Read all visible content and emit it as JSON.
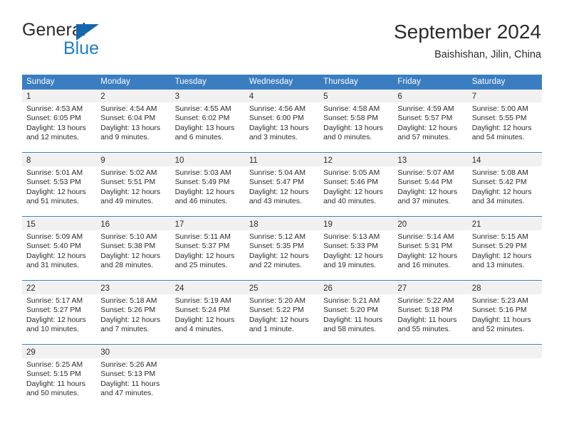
{
  "brand": {
    "name_part1": "General",
    "name_part2": "Blue",
    "triangle_color": "#1467ab",
    "blue_color": "#1f7ec4"
  },
  "header": {
    "title": "September 2024",
    "subtitle": "Baishishan, Jilin, China"
  },
  "theme": {
    "header_bg": "#3b7dc1",
    "header_text": "#ffffff",
    "daynum_band_bg": "#f1f1f1",
    "cell_bg": "#ffffff",
    "text": "#2b2b2b"
  },
  "weekdays": [
    "Sunday",
    "Monday",
    "Tuesday",
    "Wednesday",
    "Thursday",
    "Friday",
    "Saturday"
  ],
  "weeks": [
    [
      {
        "day": "1",
        "sunrise": "Sunrise: 4:53 AM",
        "sunset": "Sunset: 6:05 PM",
        "daylight1": "Daylight: 13 hours",
        "daylight2": "and 12 minutes."
      },
      {
        "day": "2",
        "sunrise": "Sunrise: 4:54 AM",
        "sunset": "Sunset: 6:04 PM",
        "daylight1": "Daylight: 13 hours",
        "daylight2": "and 9 minutes."
      },
      {
        "day": "3",
        "sunrise": "Sunrise: 4:55 AM",
        "sunset": "Sunset: 6:02 PM",
        "daylight1": "Daylight: 13 hours",
        "daylight2": "and 6 minutes."
      },
      {
        "day": "4",
        "sunrise": "Sunrise: 4:56 AM",
        "sunset": "Sunset: 6:00 PM",
        "daylight1": "Daylight: 13 hours",
        "daylight2": "and 3 minutes."
      },
      {
        "day": "5",
        "sunrise": "Sunrise: 4:58 AM",
        "sunset": "Sunset: 5:58 PM",
        "daylight1": "Daylight: 13 hours",
        "daylight2": "and 0 minutes."
      },
      {
        "day": "6",
        "sunrise": "Sunrise: 4:59 AM",
        "sunset": "Sunset: 5:57 PM",
        "daylight1": "Daylight: 12 hours",
        "daylight2": "and 57 minutes."
      },
      {
        "day": "7",
        "sunrise": "Sunrise: 5:00 AM",
        "sunset": "Sunset: 5:55 PM",
        "daylight1": "Daylight: 12 hours",
        "daylight2": "and 54 minutes."
      }
    ],
    [
      {
        "day": "8",
        "sunrise": "Sunrise: 5:01 AM",
        "sunset": "Sunset: 5:53 PM",
        "daylight1": "Daylight: 12 hours",
        "daylight2": "and 51 minutes."
      },
      {
        "day": "9",
        "sunrise": "Sunrise: 5:02 AM",
        "sunset": "Sunset: 5:51 PM",
        "daylight1": "Daylight: 12 hours",
        "daylight2": "and 49 minutes."
      },
      {
        "day": "10",
        "sunrise": "Sunrise: 5:03 AM",
        "sunset": "Sunset: 5:49 PM",
        "daylight1": "Daylight: 12 hours",
        "daylight2": "and 46 minutes."
      },
      {
        "day": "11",
        "sunrise": "Sunrise: 5:04 AM",
        "sunset": "Sunset: 5:47 PM",
        "daylight1": "Daylight: 12 hours",
        "daylight2": "and 43 minutes."
      },
      {
        "day": "12",
        "sunrise": "Sunrise: 5:05 AM",
        "sunset": "Sunset: 5:46 PM",
        "daylight1": "Daylight: 12 hours",
        "daylight2": "and 40 minutes."
      },
      {
        "day": "13",
        "sunrise": "Sunrise: 5:07 AM",
        "sunset": "Sunset: 5:44 PM",
        "daylight1": "Daylight: 12 hours",
        "daylight2": "and 37 minutes."
      },
      {
        "day": "14",
        "sunrise": "Sunrise: 5:08 AM",
        "sunset": "Sunset: 5:42 PM",
        "daylight1": "Daylight: 12 hours",
        "daylight2": "and 34 minutes."
      }
    ],
    [
      {
        "day": "15",
        "sunrise": "Sunrise: 5:09 AM",
        "sunset": "Sunset: 5:40 PM",
        "daylight1": "Daylight: 12 hours",
        "daylight2": "and 31 minutes."
      },
      {
        "day": "16",
        "sunrise": "Sunrise: 5:10 AM",
        "sunset": "Sunset: 5:38 PM",
        "daylight1": "Daylight: 12 hours",
        "daylight2": "and 28 minutes."
      },
      {
        "day": "17",
        "sunrise": "Sunrise: 5:11 AM",
        "sunset": "Sunset: 5:37 PM",
        "daylight1": "Daylight: 12 hours",
        "daylight2": "and 25 minutes."
      },
      {
        "day": "18",
        "sunrise": "Sunrise: 5:12 AM",
        "sunset": "Sunset: 5:35 PM",
        "daylight1": "Daylight: 12 hours",
        "daylight2": "and 22 minutes."
      },
      {
        "day": "19",
        "sunrise": "Sunrise: 5:13 AM",
        "sunset": "Sunset: 5:33 PM",
        "daylight1": "Daylight: 12 hours",
        "daylight2": "and 19 minutes."
      },
      {
        "day": "20",
        "sunrise": "Sunrise: 5:14 AM",
        "sunset": "Sunset: 5:31 PM",
        "daylight1": "Daylight: 12 hours",
        "daylight2": "and 16 minutes."
      },
      {
        "day": "21",
        "sunrise": "Sunrise: 5:15 AM",
        "sunset": "Sunset: 5:29 PM",
        "daylight1": "Daylight: 12 hours",
        "daylight2": "and 13 minutes."
      }
    ],
    [
      {
        "day": "22",
        "sunrise": "Sunrise: 5:17 AM",
        "sunset": "Sunset: 5:27 PM",
        "daylight1": "Daylight: 12 hours",
        "daylight2": "and 10 minutes."
      },
      {
        "day": "23",
        "sunrise": "Sunrise: 5:18 AM",
        "sunset": "Sunset: 5:26 PM",
        "daylight1": "Daylight: 12 hours",
        "daylight2": "and 7 minutes."
      },
      {
        "day": "24",
        "sunrise": "Sunrise: 5:19 AM",
        "sunset": "Sunset: 5:24 PM",
        "daylight1": "Daylight: 12 hours",
        "daylight2": "and 4 minutes."
      },
      {
        "day": "25",
        "sunrise": "Sunrise: 5:20 AM",
        "sunset": "Sunset: 5:22 PM",
        "daylight1": "Daylight: 12 hours",
        "daylight2": "and 1 minute."
      },
      {
        "day": "26",
        "sunrise": "Sunrise: 5:21 AM",
        "sunset": "Sunset: 5:20 PM",
        "daylight1": "Daylight: 11 hours",
        "daylight2": "and 58 minutes."
      },
      {
        "day": "27",
        "sunrise": "Sunrise: 5:22 AM",
        "sunset": "Sunset: 5:18 PM",
        "daylight1": "Daylight: 11 hours",
        "daylight2": "and 55 minutes."
      },
      {
        "day": "28",
        "sunrise": "Sunrise: 5:23 AM",
        "sunset": "Sunset: 5:16 PM",
        "daylight1": "Daylight: 11 hours",
        "daylight2": "and 52 minutes."
      }
    ],
    [
      {
        "day": "29",
        "sunrise": "Sunrise: 5:25 AM",
        "sunset": "Sunset: 5:15 PM",
        "daylight1": "Daylight: 11 hours",
        "daylight2": "and 50 minutes."
      },
      {
        "day": "30",
        "sunrise": "Sunrise: 5:26 AM",
        "sunset": "Sunset: 5:13 PM",
        "daylight1": "Daylight: 11 hours",
        "daylight2": "and 47 minutes."
      },
      {
        "day": "",
        "sunrise": "",
        "sunset": "",
        "daylight1": "",
        "daylight2": ""
      },
      {
        "day": "",
        "sunrise": "",
        "sunset": "",
        "daylight1": "",
        "daylight2": ""
      },
      {
        "day": "",
        "sunrise": "",
        "sunset": "",
        "daylight1": "",
        "daylight2": ""
      },
      {
        "day": "",
        "sunrise": "",
        "sunset": "",
        "daylight1": "",
        "daylight2": ""
      },
      {
        "day": "",
        "sunrise": "",
        "sunset": "",
        "daylight1": "",
        "daylight2": ""
      }
    ]
  ]
}
